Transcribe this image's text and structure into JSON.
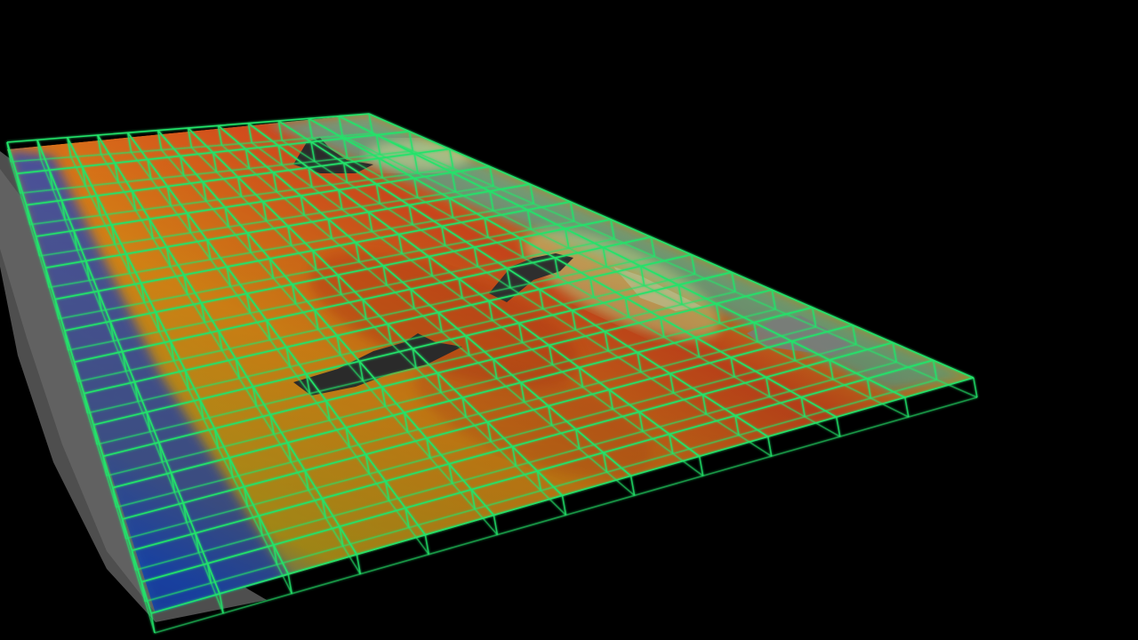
{
  "scene": {
    "background_color": "#000000",
    "grid_color": "#22e36a",
    "surface_colormap": [
      "#1a3fbf",
      "#2a7fe0",
      "#24c4c8",
      "#8ed35a",
      "#d9c21e",
      "#e07a12",
      "#c8401a"
    ],
    "terrain_color": "#5a5a5a",
    "grid_columns": 12,
    "grid_rows": 15,
    "grid_layers": 2
  }
}
